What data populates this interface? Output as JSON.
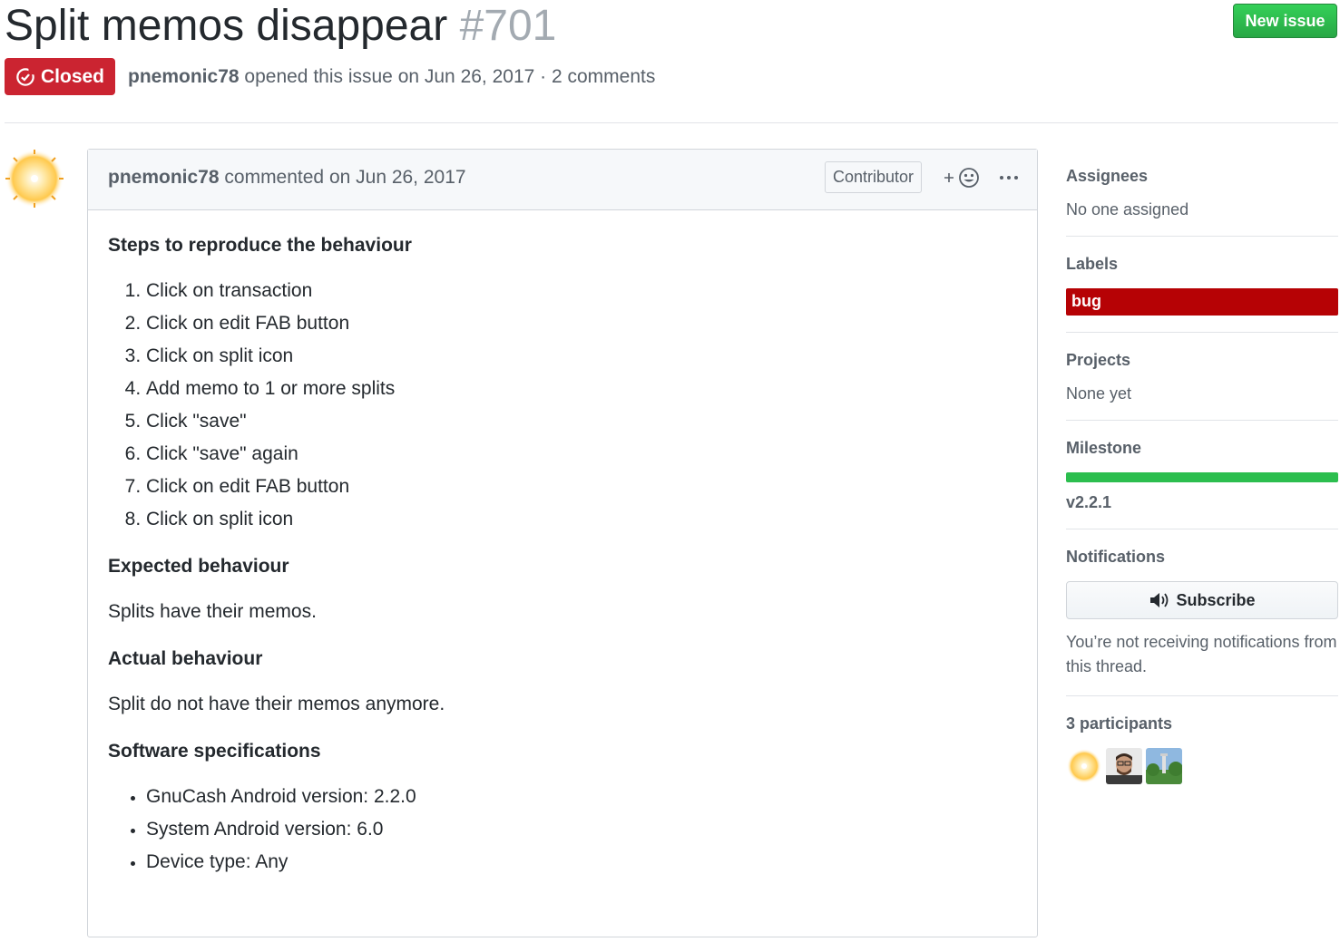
{
  "issue": {
    "title": "Split memos disappear",
    "number": "#701",
    "state": "Closed",
    "author": "pnemonic78",
    "opened_text": "opened this issue on Jun 26, 2017 · 2 comments",
    "new_issue_label": "New issue"
  },
  "comment": {
    "author": "pnemonic78",
    "commented_text": "commented on Jun 26, 2017",
    "role_badge": "Contributor",
    "steps_heading": "Steps to reproduce the behaviour",
    "steps": [
      "Click on transaction",
      "Click on edit FAB button",
      "Click on split icon",
      "Add memo to 1 or more splits",
      "Click \"save\"",
      "Click \"save\" again",
      "Click on edit FAB button",
      "Click on split icon"
    ],
    "expected_heading": "Expected behaviour",
    "expected_text": "Splits have their memos.",
    "actual_heading": "Actual behaviour",
    "actual_text": "Split do not have their memos anymore.",
    "specs_heading": "Software specifications",
    "specs": [
      "GnuCash Android version: 2.2.0",
      "System Android version: 6.0",
      "Device type: Any"
    ]
  },
  "sidebar": {
    "assignees_title": "Assignees",
    "assignees_value": "No one assigned",
    "labels_title": "Labels",
    "label_bug": "bug",
    "projects_title": "Projects",
    "projects_value": "None yet",
    "milestone_title": "Milestone",
    "milestone_name": "v2.2.1",
    "milestone_progress": 1.0,
    "notifications_title": "Notifications",
    "subscribe_label": "Subscribe",
    "notif_reason": "You’re not receiving notifications from this thread.",
    "participants_title": "3 participants"
  },
  "colors": {
    "closed_red": "#cb2431",
    "bug_label": "#b60205",
    "new_issue_green": "#28a745",
    "milestone_green": "#2cbe4e"
  }
}
